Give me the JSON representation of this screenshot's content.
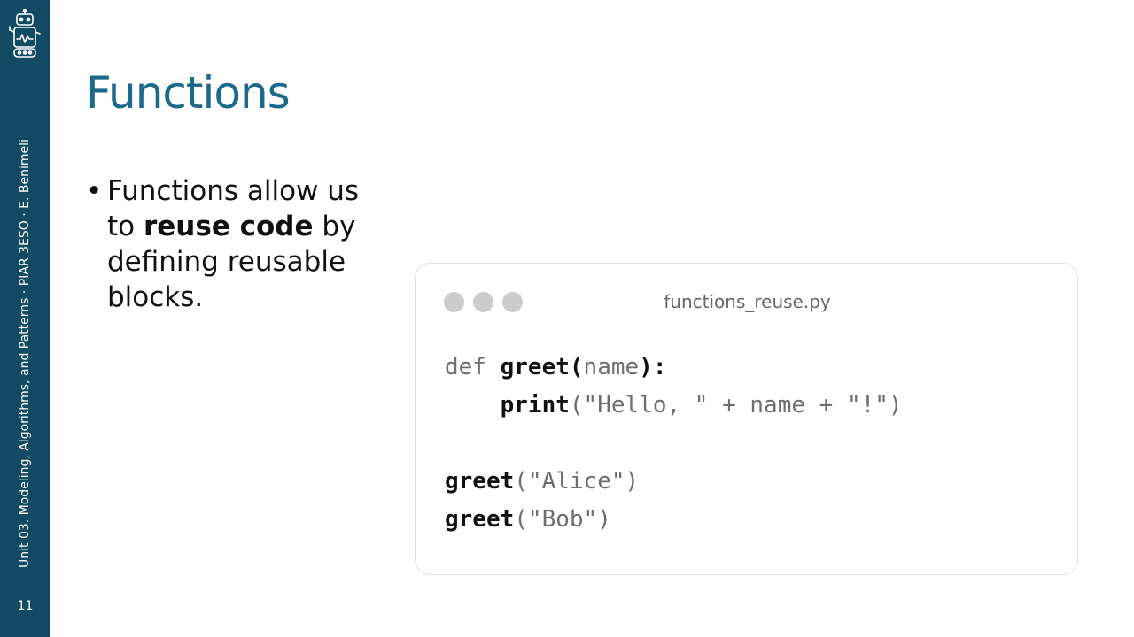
{
  "sidebar": {
    "vertical_text": "Unit 03. Modeling, Algorithms, and Patterns · PIAR 3ESO · E. Benimeli",
    "page_number": "11",
    "logo_icon": "robot-icon",
    "color": "#134a63"
  },
  "slide": {
    "title": "Functions",
    "bullet": {
      "marker": "•",
      "part1": "Functions allow us to ",
      "bold": "reuse code",
      "part2": " by defining reusable blocks."
    },
    "title_color": "#1b6a8c"
  },
  "code_window": {
    "filename": "functions_reuse.py",
    "lines": [
      [
        {
          "t": "def ",
          "c": "k"
        },
        {
          "t": "greet(",
          "c": "fn"
        },
        {
          "t": "name",
          "c": "p"
        },
        {
          "t": "):",
          "c": "fn"
        }
      ],
      [
        {
          "t": "    ",
          "c": "p"
        },
        {
          "t": "print",
          "c": "fn"
        },
        {
          "t": "(\"Hello, \" + name + \"!\")",
          "c": "s"
        }
      ],
      [],
      [
        {
          "t": "greet",
          "c": "fn"
        },
        {
          "t": "(\"Alice\")",
          "c": "s"
        }
      ],
      [
        {
          "t": "greet",
          "c": "fn"
        },
        {
          "t": "(\"Bob\")",
          "c": "s"
        }
      ]
    ]
  }
}
